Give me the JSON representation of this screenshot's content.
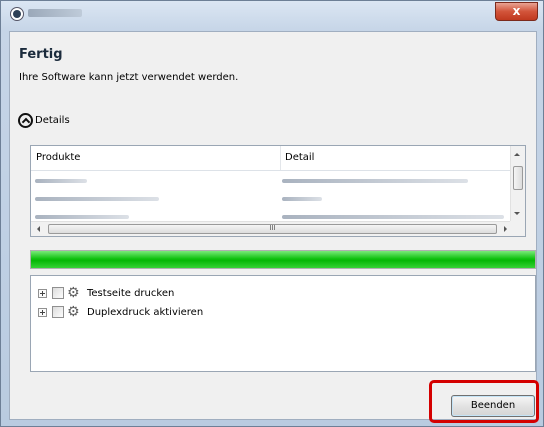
{
  "window": {
    "close_label": "x"
  },
  "header": {
    "title": "Fertig",
    "subtitle": "Ihre Software kann jetzt verwendet werden."
  },
  "details": {
    "label": "Details"
  },
  "table": {
    "columns": [
      "Produkte",
      "Detail"
    ],
    "scroll_grip": "III"
  },
  "progress": {
    "percent": 100,
    "color": "#11c211"
  },
  "tree": {
    "items": [
      {
        "label": "Testseite drucken",
        "icon": "gear-icon",
        "checked": false
      },
      {
        "label": "Duplexdruck aktivieren",
        "icon": "gear-icon",
        "checked": false
      }
    ]
  },
  "footer": {
    "finish_label": "Beenden",
    "highlight_color": "#d40000"
  }
}
